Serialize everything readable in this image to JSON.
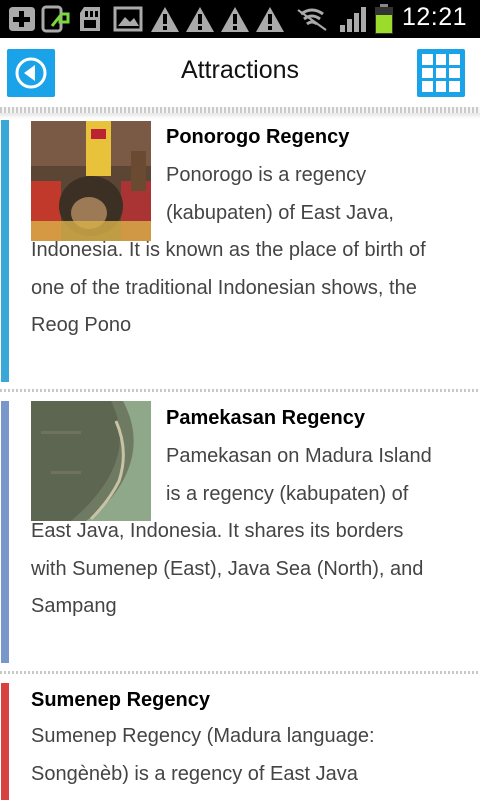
{
  "status_bar": {
    "time": "12:21",
    "icons": [
      "add-icon",
      "phone-sync-icon",
      "sd-card-icon",
      "image-icon",
      "warning-icon",
      "warning-icon",
      "warning-icon",
      "warning-icon",
      "no-signal-icon",
      "signal-icon",
      "battery-icon"
    ]
  },
  "header": {
    "title": "Attractions",
    "back_icon": "back-arrow-icon",
    "grid_icon": "grid-icon",
    "accent_color": "#1aa3e8"
  },
  "items": [
    {
      "title": "Ponorogo Regency",
      "description": "Ponorogo is a regency (kabupaten) of East Java, Indonesia. It is known as the place of birth of one of the traditional Indonesian shows, the Reog Pono",
      "accent_color": "#3aa7d9",
      "thumbnail": "reog-mask-photo"
    },
    {
      "title": "Pamekasan Regency",
      "description": "Pamekasan on Madura Island is a regency (kabupaten) of East Java, Indonesia. It shares its borders with Sumenep (East), Java Sea (North), and Sampang",
      "accent_color": "#7a97cc",
      "thumbnail": "aerial-coast-photo"
    },
    {
      "title": "Sumenep Regency",
      "description": "Sumenep Regency (Madura language: Songènèb) is a regency of East Java",
      "accent_color": "#d94040"
    }
  ]
}
